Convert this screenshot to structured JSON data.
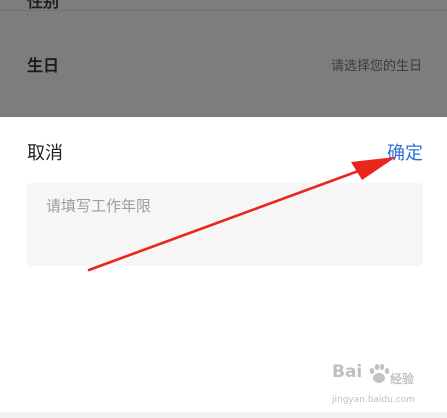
{
  "background_form": {
    "partial_row_label": "性别",
    "birthday_label": "生日",
    "birthday_placeholder": "请选择您的生日"
  },
  "sheet": {
    "cancel_label": "取消",
    "confirm_label": "确定",
    "input_placeholder": "请填写工作年限",
    "input_value": ""
  },
  "watermark": {
    "logo_left": "Bai",
    "logo_right": "经验",
    "domain": "jingyan.baidu.com"
  },
  "colors": {
    "confirm": "#2f6fd6",
    "overlay": "#7d7d7d",
    "arrow": "#e8261c"
  }
}
